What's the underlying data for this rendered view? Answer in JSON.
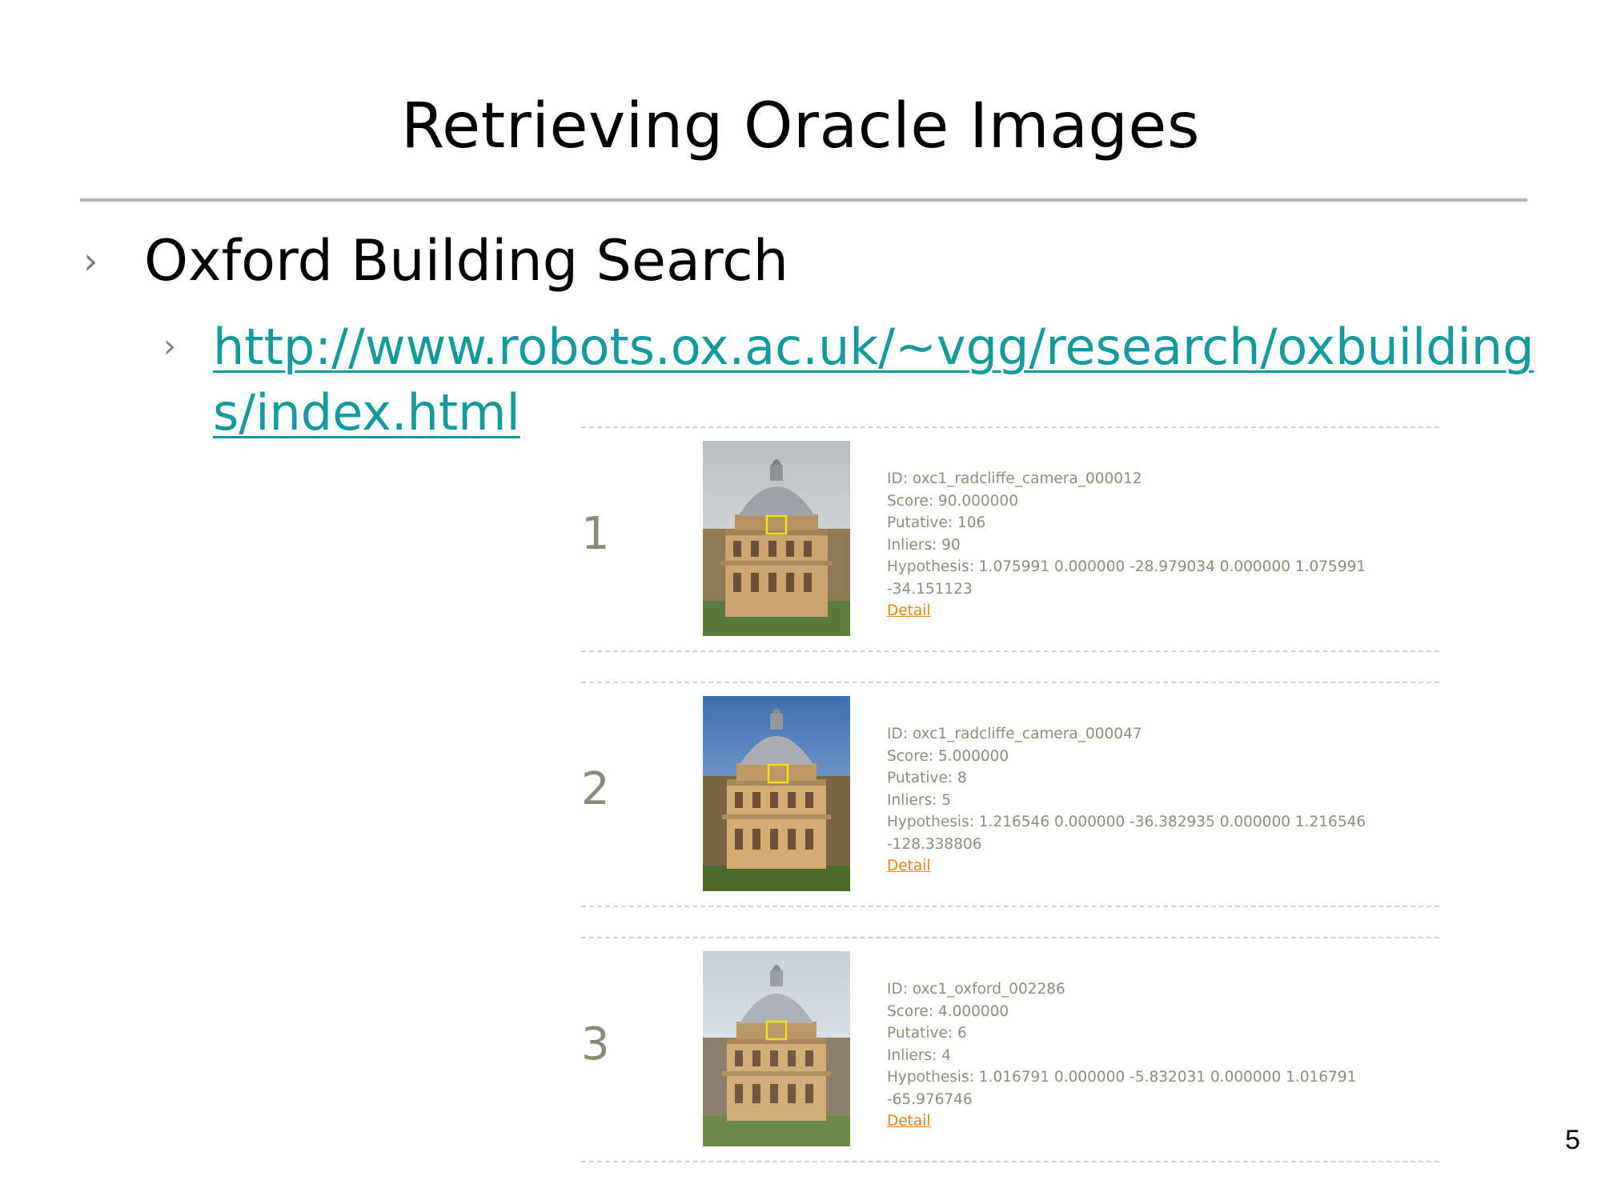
{
  "slide": {
    "title": "Retrieving Oracle Images",
    "bullet_marker": "›",
    "bullet": "Oxford Building Search",
    "link": "http://www.robots.ox.ac.uk/~vgg/research/oxbuildings/index.html",
    "page_number": "5"
  },
  "results": [
    {
      "rank": "1",
      "id": "ID: oxc1_radcliffe_camera_000012",
      "score": "Score: 90.000000",
      "putative": "Putative: 106",
      "inliers": "Inliers: 90",
      "hypothesis": "Hypothesis: 1.075991 0.000000 -28.979034 0.000000 1.075991 -34.151123",
      "detail": "Detail"
    },
    {
      "rank": "2",
      "id": "ID: oxc1_radcliffe_camera_000047",
      "score": "Score: 5.000000",
      "putative": "Putative: 8",
      "inliers": "Inliers: 5",
      "hypothesis": "Hypothesis: 1.216546 0.000000 -36.382935 0.000000 1.216546 -128.338806",
      "detail": "Detail"
    },
    {
      "rank": "3",
      "id": "ID: oxc1_oxford_002286",
      "score": "Score: 4.000000",
      "putative": "Putative: 6",
      "inliers": "Inliers: 4",
      "hypothesis": "Hypothesis: 1.016791 0.000000 -5.832031 0.000000 1.016791 -65.976746",
      "detail": "Detail"
    }
  ],
  "colors": {
    "link": "#139a9a",
    "detail_link": "#e8840a",
    "meta_text": "#8c8c7c",
    "rule": "#b3b3b3",
    "roi_box": "#f2e21a"
  }
}
